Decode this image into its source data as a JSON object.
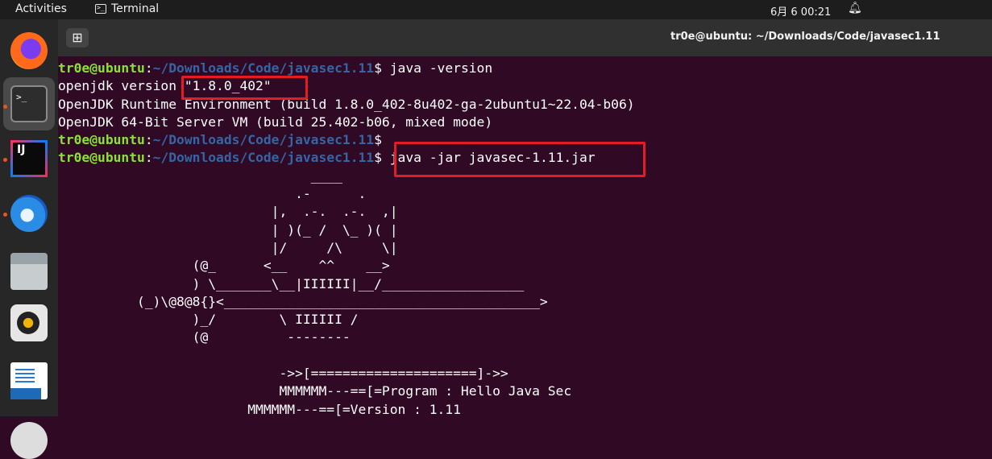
{
  "topbar": {
    "activities": "Activities",
    "app_name": "Terminal",
    "app_icon": ">_",
    "clock": "6月 6  00:21",
    "bell_icon": "bell-icon"
  },
  "window": {
    "title": "tr0e@ubuntu: ~/Downloads/Code/javasec1.11",
    "new_tab_symbol": "⊞"
  },
  "dock": {
    "apps": [
      "Firefox",
      "Terminal",
      "IntelliJ IDEA",
      "Thunderbird",
      "Files",
      "Rhythmbox",
      "LibreOffice Writer"
    ],
    "terminal_glyph": ">_",
    "intellij_glyph": "IJ"
  },
  "terminal": {
    "user": "tr0e@ubuntu",
    "colon": ":",
    "path": "~/Downloads/Code/javasec1.11",
    "prompt_sep": "$ ",
    "cmd1": "java -version",
    "out1": "openjdk version \"1.8.0_402\"",
    "out2": "OpenJDK Runtime Environment (build 1.8.0_402-8u402-ga-2ubuntu1~22.04-b06)",
    "out3": "OpenJDK 64-Bit Server VM (build 25.402-b06, mixed mode)",
    "cmd2": "",
    "cmd3": "java -jar javasec-1.11.jar",
    "art": [
      "                                ____",
      "                              .-      .",
      "                           |,  .-.  .-.  ,|",
      "                           | )(_ /  \\_ )( |",
      "                           |/     /\\     \\|",
      "                 (@_      <__    ^^    __>",
      "                 ) \\_______\\__|IIIIII|__/__________________",
      "          (_)\\@8@8{}<________________________________________>",
      "                 )_/        \\ IIIIII /",
      "                 (@          --------",
      "",
      "                            ->>[=====================]->>",
      "                            MMMMMM---==[=Program : Hello Java Sec",
      "                        MMMMMM---==[=Version : 1.11"
    ]
  }
}
